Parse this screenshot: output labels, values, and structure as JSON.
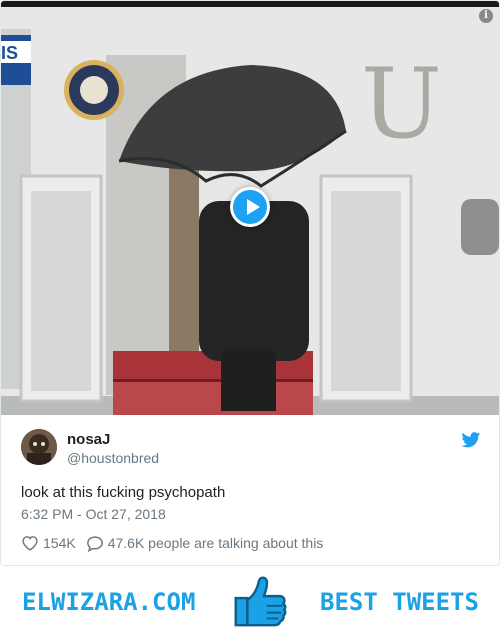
{
  "tweet": {
    "author_name": "nosaJ",
    "author_handle": "@houstonbred",
    "text": "look at this fucking psychopath",
    "timestamp": "6:32 PM - Oct 27, 2018",
    "like_count": "154K",
    "talking_text": "47.6K people are talking about this"
  },
  "media": {
    "type": "video",
    "overlay_text_left": "IS",
    "aircraft_letter": "U"
  },
  "banner": {
    "left_text": "ELWIZARA.COM",
    "right_text": "BEST TWEETS"
  },
  "colors": {
    "brand": "#1ba1e6",
    "twitter_blue": "#1da1f2",
    "secondary_text": "#697882"
  },
  "icons": [
    "info-icon",
    "play-icon",
    "twitter-bird-icon",
    "heart-icon",
    "speech-bubble-icon",
    "thumbs-up-icon"
  ]
}
